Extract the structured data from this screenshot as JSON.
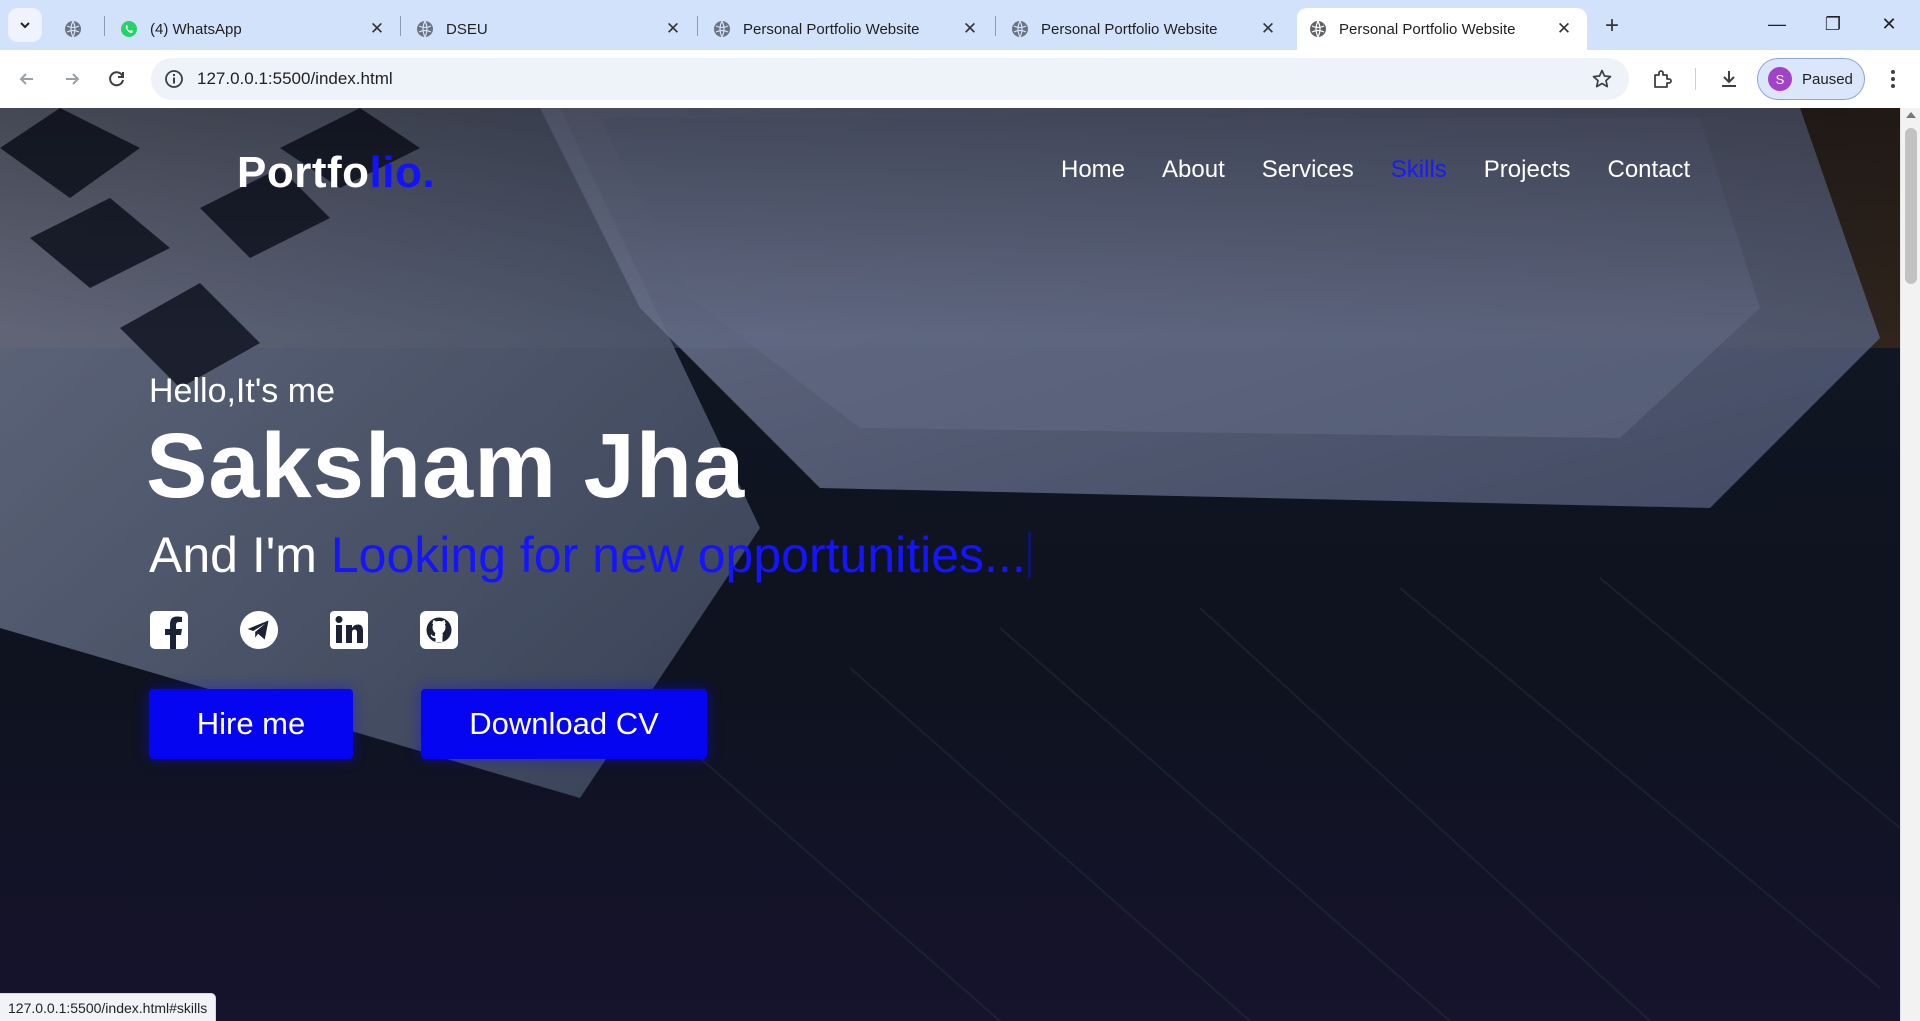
{
  "browser": {
    "tabs": [
      {
        "title": "",
        "icon": "globe-icon"
      },
      {
        "title": "(4) WhatsApp",
        "icon": "whatsapp-icon"
      },
      {
        "title": "DSEU",
        "icon": "globe-icon"
      },
      {
        "title": "Personal Portfolio Website",
        "icon": "globe-icon"
      },
      {
        "title": "Personal Portfolio Website",
        "icon": "globe-icon"
      },
      {
        "title": "Personal Portfolio Website",
        "icon": "globe-icon",
        "active": true
      }
    ],
    "close_glyph": "✕",
    "new_tab_glyph": "+",
    "window_controls": {
      "minimize": "—",
      "restore": "❐",
      "close": "✕"
    },
    "url": "127.0.0.1:5500/index.html",
    "profile": {
      "initial": "S",
      "label": "Paused",
      "color": "#a142c9"
    },
    "status_url": "127.0.0.1:5500/index.html#skills"
  },
  "site": {
    "logo": {
      "main": "Portfo",
      "accent": "lio."
    },
    "nav": [
      {
        "label": "Home"
      },
      {
        "label": "About"
      },
      {
        "label": "Services"
      },
      {
        "label": "Skills",
        "active": true
      },
      {
        "label": "Projects"
      },
      {
        "label": "Contact"
      }
    ],
    "hero": {
      "greeting": "Hello,It's me",
      "name": "Saksham Jha",
      "role_prefix": "And I'm",
      "role_typed": "Looking for new opportunities..."
    },
    "socials": [
      "facebook-icon",
      "telegram-icon",
      "linkedin-icon",
      "github-icon"
    ],
    "buttons": {
      "hire": "Hire me",
      "cv": "Download CV"
    }
  },
  "colors": {
    "accent": "#0505f2",
    "nav_active": "#1a1aff",
    "text": "#ffffff"
  }
}
